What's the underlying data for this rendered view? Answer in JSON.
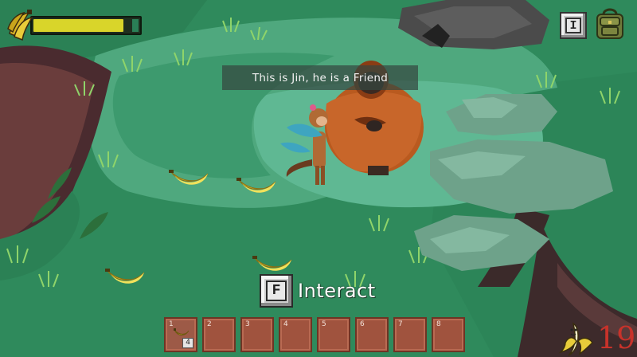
{
  "dialog": {
    "text": "This is Jin, he is a Friend"
  },
  "hud": {
    "energy_level": 0.93,
    "inventory_key": "I",
    "banana_count": "19"
  },
  "prompt": {
    "key": "F",
    "label": "Interact"
  },
  "hotbar": {
    "slots": [
      {
        "number": "1",
        "item": "banana",
        "count": "4"
      },
      {
        "number": "2"
      },
      {
        "number": "3"
      },
      {
        "number": "4"
      },
      {
        "number": "5"
      },
      {
        "number": "6"
      },
      {
        "number": "7"
      },
      {
        "number": "8"
      }
    ]
  },
  "icons": {
    "energy": "banana-bunch-icon",
    "inventory": "backpack-icon",
    "counter": "banana-peeled-icon"
  },
  "colors": {
    "ground": "#2f8a5c",
    "path": "#5fb893",
    "energy_fill": "#d9d52a",
    "counter_text": "#c8322a",
    "slot": "#a0533e"
  }
}
